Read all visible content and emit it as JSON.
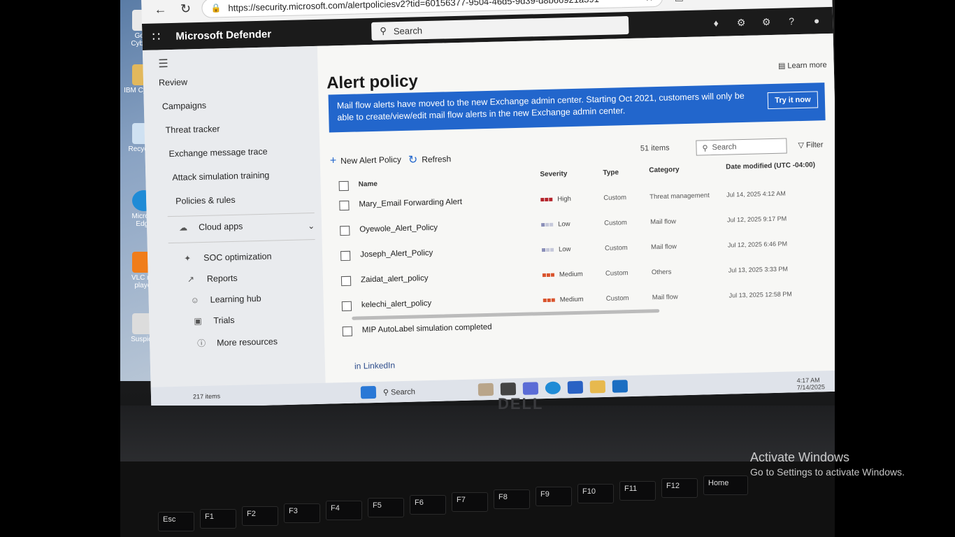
{
  "browser": {
    "url": "https://security.microsoft.com/alertpoliciesv2?tid=60156377-9504-46d5-9d39-d8b66921a391"
  },
  "header": {
    "app_title": "Microsoft Defender",
    "search_placeholder": "Search"
  },
  "sidebar": {
    "items": [
      {
        "label": "Review"
      },
      {
        "label": "Campaigns"
      },
      {
        "label": "Threat tracker"
      },
      {
        "label": "Exchange message trace"
      },
      {
        "label": "Attack simulation training"
      },
      {
        "label": "Policies & rules"
      },
      {
        "label": "Cloud apps"
      },
      {
        "label": "SOC optimization"
      },
      {
        "label": "Reports"
      },
      {
        "label": "Learning hub"
      },
      {
        "label": "Trials"
      },
      {
        "label": "More resources"
      }
    ]
  },
  "main": {
    "title": "Alert policy",
    "learn_more": "Learn more",
    "banner_text": "Mail flow alerts have moved to the new Exchange admin center. Starting Oct 2021, customers will only be able to create/view/edit mail flow alerts in the new Exchange admin center.",
    "banner_button": "Try it now",
    "new_policy": "New Alert Policy",
    "refresh": "Refresh",
    "items_count": "51 items",
    "list_search": "Search",
    "filter": "Filter",
    "columns": {
      "name": "Name",
      "severity": "Severity",
      "type": "Type",
      "category": "Category",
      "date": "Date modified (UTC -04:00)"
    },
    "rows": [
      {
        "name": "Mary_Email Forwarding Alert",
        "severity": "High",
        "type": "Custom",
        "category": "Threat management",
        "date": "Jul 14, 2025 4:12 AM"
      },
      {
        "name": "Oyewole_Alert_Policy",
        "severity": "Low",
        "type": "Custom",
        "category": "Mail flow",
        "date": "Jul 12, 2025 9:17 PM"
      },
      {
        "name": "Joseph_Alert_Policy",
        "severity": "Low",
        "type": "Custom",
        "category": "Mail flow",
        "date": "Jul 12, 2025 6:46 PM"
      },
      {
        "name": "Zaidat_alert_policy",
        "severity": "Medium",
        "type": "Custom",
        "category": "Others",
        "date": "Jul 13, 2025 3:33 PM"
      },
      {
        "name": "kelechi_alert_policy",
        "severity": "Medium",
        "type": "Custom",
        "category": "Mail flow",
        "date": "Jul 13, 2025 12:58 PM"
      },
      {
        "name": "MIP AutoLabel simulation completed",
        "severity": "",
        "type": "",
        "category": "",
        "date": ""
      }
    ]
  },
  "desktop": {
    "icons": [
      {
        "label": "Googl Cyberse"
      },
      {
        "label": "IBM Cyberse"
      },
      {
        "label": "Recycle B"
      },
      {
        "label": "Microso Edge"
      },
      {
        "label": "VLC me player"
      },
      {
        "label": "Suspicio"
      }
    ]
  },
  "taskbar": {
    "search": "Search",
    "linkedin": "LinkedIn",
    "time": "4:17 AM",
    "date": "7/14/2025",
    "items_label": "217 items"
  },
  "laptop": {
    "brand": "DELL",
    "keys": [
      "Esc",
      "F1",
      "F2",
      "F3",
      "F4",
      "F5",
      "F6",
      "F7",
      "F8",
      "F9",
      "F10",
      "F11",
      "F12",
      "Home"
    ]
  },
  "overlay": {
    "activate_title": "Activate Windows",
    "activate_sub": "Go to Settings to activate Windows."
  },
  "colors": {
    "accent": "#2266cc",
    "sev_high": "#b4232a",
    "sev_medium": "#d9532c",
    "sev_low": "#8a8fb8"
  }
}
